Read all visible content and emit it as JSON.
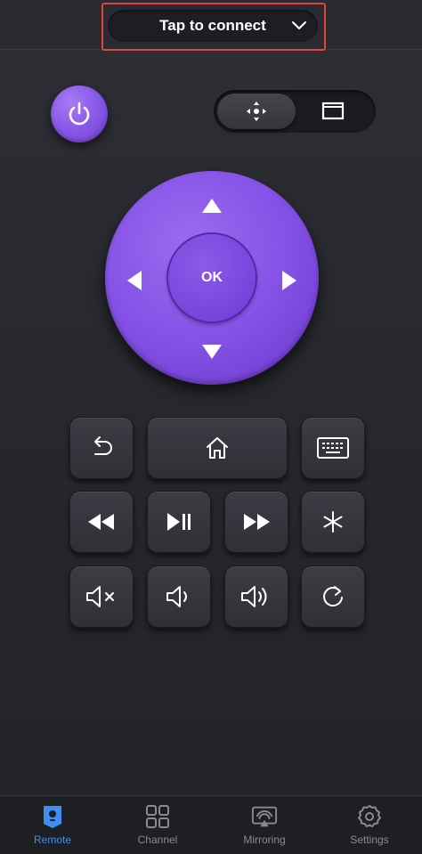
{
  "header": {
    "connect_label": "Tap to connect",
    "chevron_icon": "chevron-down-icon"
  },
  "colors": {
    "accent_purple": "#8552e6",
    "highlight_red": "#e2453d",
    "active_nav_blue": "#3f8ff0",
    "background": "#2a2b30"
  },
  "controls": {
    "power_icon": "power-icon",
    "mode_toggle": {
      "options": [
        "dpad-mode-icon",
        "touchpad-mode-icon"
      ],
      "selected": "dpad-mode-icon"
    },
    "dpad": {
      "ok_label": "OK",
      "arrows": [
        "up",
        "left",
        "right",
        "down"
      ]
    },
    "keys": [
      "back-icon",
      "home-icon",
      "keyboard-icon",
      "rewind-icon",
      "play-pause-icon",
      "fast-forward-icon",
      "options-asterisk-icon",
      "mute-icon",
      "volume-down-icon",
      "volume-up-icon",
      "replay-icon"
    ]
  },
  "bottom_nav": {
    "items": [
      {
        "label": "Remote",
        "icon": "remote-icon",
        "active": true
      },
      {
        "label": "Channel",
        "icon": "grid-icon",
        "active": false
      },
      {
        "label": "Mirroring",
        "icon": "screen-mirror-icon",
        "active": false
      },
      {
        "label": "Settings",
        "icon": "gear-icon",
        "active": false
      }
    ]
  }
}
